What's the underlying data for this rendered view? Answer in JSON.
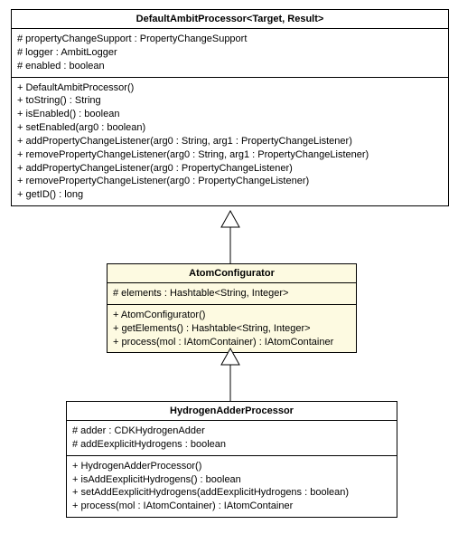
{
  "classes": {
    "top": {
      "title": "DefaultAmbitProcessor<Target, Result>",
      "attrs": [
        "# propertyChangeSupport : PropertyChangeSupport",
        "# logger : AmbitLogger",
        "# enabled : boolean"
      ],
      "methods": [
        "+ DefaultAmbitProcessor()",
        "+ toString() : String",
        "+ isEnabled() : boolean",
        "+ setEnabled(arg0 : boolean)",
        "+ addPropertyChangeListener(arg0 : String, arg1 : PropertyChangeListener)",
        "+ removePropertyChangeListener(arg0 : String, arg1 : PropertyChangeListener)",
        "+ addPropertyChangeListener(arg0 : PropertyChangeListener)",
        "+ removePropertyChangeListener(arg0 : PropertyChangeListener)",
        "+ getID() : long"
      ]
    },
    "mid": {
      "title": "AtomConfigurator",
      "attrs": [
        "# elements : Hashtable<String, Integer>"
      ],
      "methods": [
        "+ AtomConfigurator()",
        "+ getElements() : Hashtable<String, Integer>",
        "+ process(mol : IAtomContainer) : IAtomContainer"
      ]
    },
    "bot": {
      "title": "HydrogenAdderProcessor",
      "attrs": [
        "# adder : CDKHydrogenAdder",
        "# addEexplicitHydrogens : boolean"
      ],
      "methods": [
        "+ HydrogenAdderProcessor()",
        "+ isAddEexplicitHydrogens() : boolean",
        "+ setAddEexplicitHydrogens(addEexplicitHydrogens : boolean)",
        "+ process(mol : IAtomContainer) : IAtomContainer"
      ]
    }
  }
}
